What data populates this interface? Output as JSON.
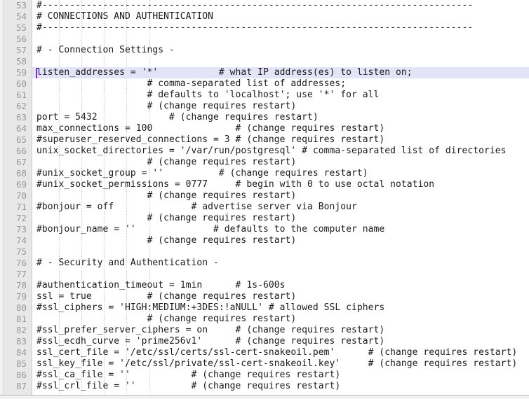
{
  "editor": {
    "first_line_number": 53,
    "line_height_px": 16,
    "cursor_line": 59,
    "cursor_column": 1,
    "highlight_color": "#e4e4f8",
    "caret_color": "#8a2be2",
    "gutter_color": "#e8e8e8",
    "line_number_color": "#999999",
    "text_color": "#1a1a1a",
    "background_color": "#ffffff"
  },
  "lines": [
    {
      "num": "53",
      "text": "#------------------------------------------------------------------------------"
    },
    {
      "num": "54",
      "text": "# CONNECTIONS AND AUTHENTICATION"
    },
    {
      "num": "55",
      "text": "#------------------------------------------------------------------------------"
    },
    {
      "num": "56",
      "text": ""
    },
    {
      "num": "57",
      "text": "# - Connection Settings -"
    },
    {
      "num": "58",
      "text": ""
    },
    {
      "num": "59",
      "text": "listen_addresses = '*'           # what IP address(es) to listen on;"
    },
    {
      "num": "60",
      "text": "                    # comma-separated list of addresses;"
    },
    {
      "num": "61",
      "text": "                    # defaults to 'localhost'; use '*' for all"
    },
    {
      "num": "62",
      "text": "                    # (change requires restart)"
    },
    {
      "num": "63",
      "text": "port = 5432             # (change requires restart)"
    },
    {
      "num": "64",
      "text": "max_connections = 100               # (change requires restart)"
    },
    {
      "num": "65",
      "text": "#superuser_reserved_connections = 3 # (change requires restart)"
    },
    {
      "num": "66",
      "text": "unix_socket_directories = '/var/run/postgresql' # comma-separated list of directories"
    },
    {
      "num": "67",
      "text": "                    # (change requires restart)"
    },
    {
      "num": "68",
      "text": "#unix_socket_group = ''          # (change requires restart)"
    },
    {
      "num": "69",
      "text": "#unix_socket_permissions = 0777     # begin with 0 to use octal notation"
    },
    {
      "num": "70",
      "text": "                    # (change requires restart)"
    },
    {
      "num": "71",
      "text": "#bonjour = off              # advertise server via Bonjour"
    },
    {
      "num": "72",
      "text": "                    # (change requires restart)"
    },
    {
      "num": "73",
      "text": "#bonjour_name = ''              # defaults to the computer name"
    },
    {
      "num": "74",
      "text": "                    # (change requires restart)"
    },
    {
      "num": "75",
      "text": ""
    },
    {
      "num": "76",
      "text": "# - Security and Authentication -"
    },
    {
      "num": "77",
      "text": ""
    },
    {
      "num": "78",
      "text": "#authentication_timeout = 1min      # 1s-600s"
    },
    {
      "num": "79",
      "text": "ssl = true          # (change requires restart)"
    },
    {
      "num": "80",
      "text": "#ssl_ciphers = 'HIGH:MEDIUM:+3DES:!aNULL' # allowed SSL ciphers"
    },
    {
      "num": "81",
      "text": "                    # (change requires restart)"
    },
    {
      "num": "82",
      "text": "#ssl_prefer_server_ciphers = on     # (change requires restart)"
    },
    {
      "num": "83",
      "text": "#ssl_ecdh_curve = 'prime256v1'      # (change requires restart)"
    },
    {
      "num": "84",
      "text": "ssl_cert_file = '/etc/ssl/certs/ssl-cert-snakeoil.pem'      # (change requires restart)"
    },
    {
      "num": "85",
      "text": "ssl_key_file = '/etc/ssl/private/ssl-cert-snakeoil.key'     # (change requires restart)"
    },
    {
      "num": "86",
      "text": "#ssl_ca_file = ''           # (change requires restart)"
    },
    {
      "num": "87",
      "text": "#ssl_crl_file = ''          # (change requires restart)"
    }
  ],
  "indent_guide_columns": [
    4,
    8,
    12,
    16,
    20
  ]
}
